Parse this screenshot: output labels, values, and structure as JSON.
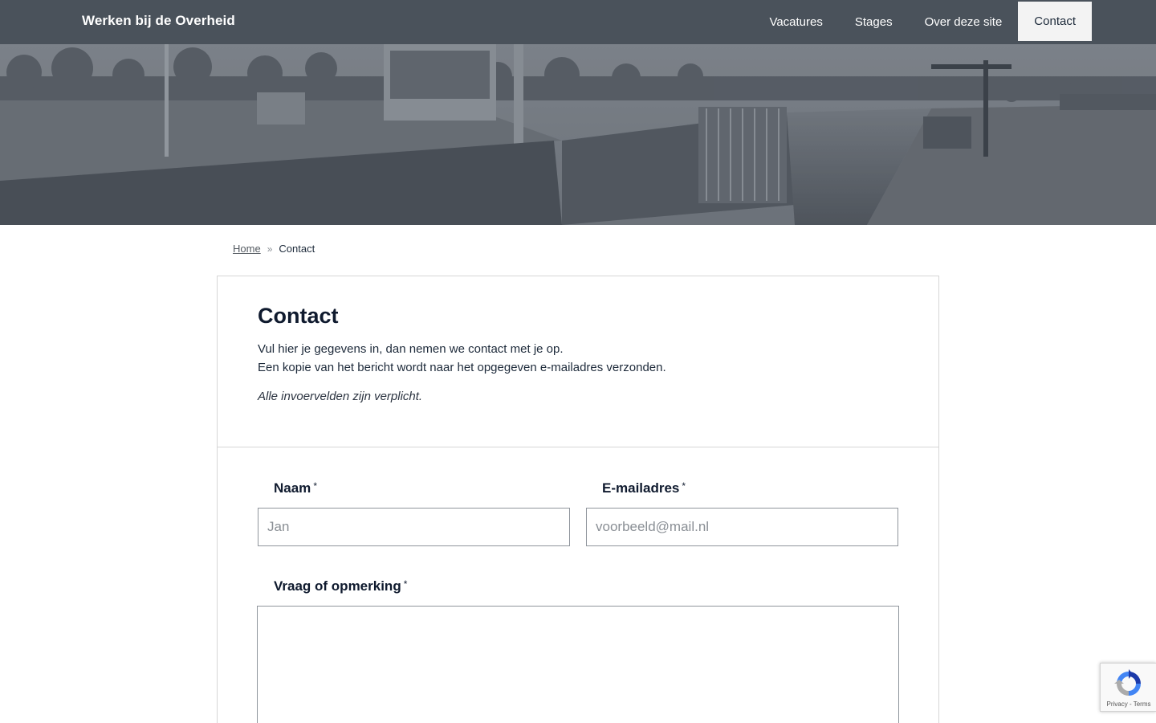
{
  "header": {
    "brand": "Werken bij de Overheid",
    "nav": [
      {
        "label": "Vacatures",
        "active": false
      },
      {
        "label": "Stages",
        "active": false
      },
      {
        "label": "Over deze site",
        "active": false
      },
      {
        "label": "Contact",
        "active": true
      }
    ]
  },
  "breadcrumb": {
    "home": "Home",
    "separator": "»",
    "current": "Contact"
  },
  "card": {
    "title": "Contact",
    "intro_line1": "Vul hier je gegevens in, dan nemen we contact met je op.",
    "intro_line2": "Een kopie van het bericht wordt naar het opgegeven e-mailadres verzonden.",
    "required_note": "Alle invoervelden zijn verplicht."
  },
  "form": {
    "name_label": "Naam",
    "name_placeholder": "Jan",
    "name_value": "",
    "email_label": "E-mailadres",
    "email_placeholder": "voorbeeld@mail.nl",
    "email_value": "",
    "message_label": "Vraag of opmerking",
    "message_value": "",
    "required_marker": "*"
  },
  "recaptcha": {
    "icon": "recaptcha-icon",
    "privacy": "Privacy",
    "sep": " - ",
    "terms": "Terms"
  },
  "colors": {
    "topbar": "#4a525b",
    "active_tab": "#f3f3f3",
    "heading": "#0f1a2e"
  }
}
